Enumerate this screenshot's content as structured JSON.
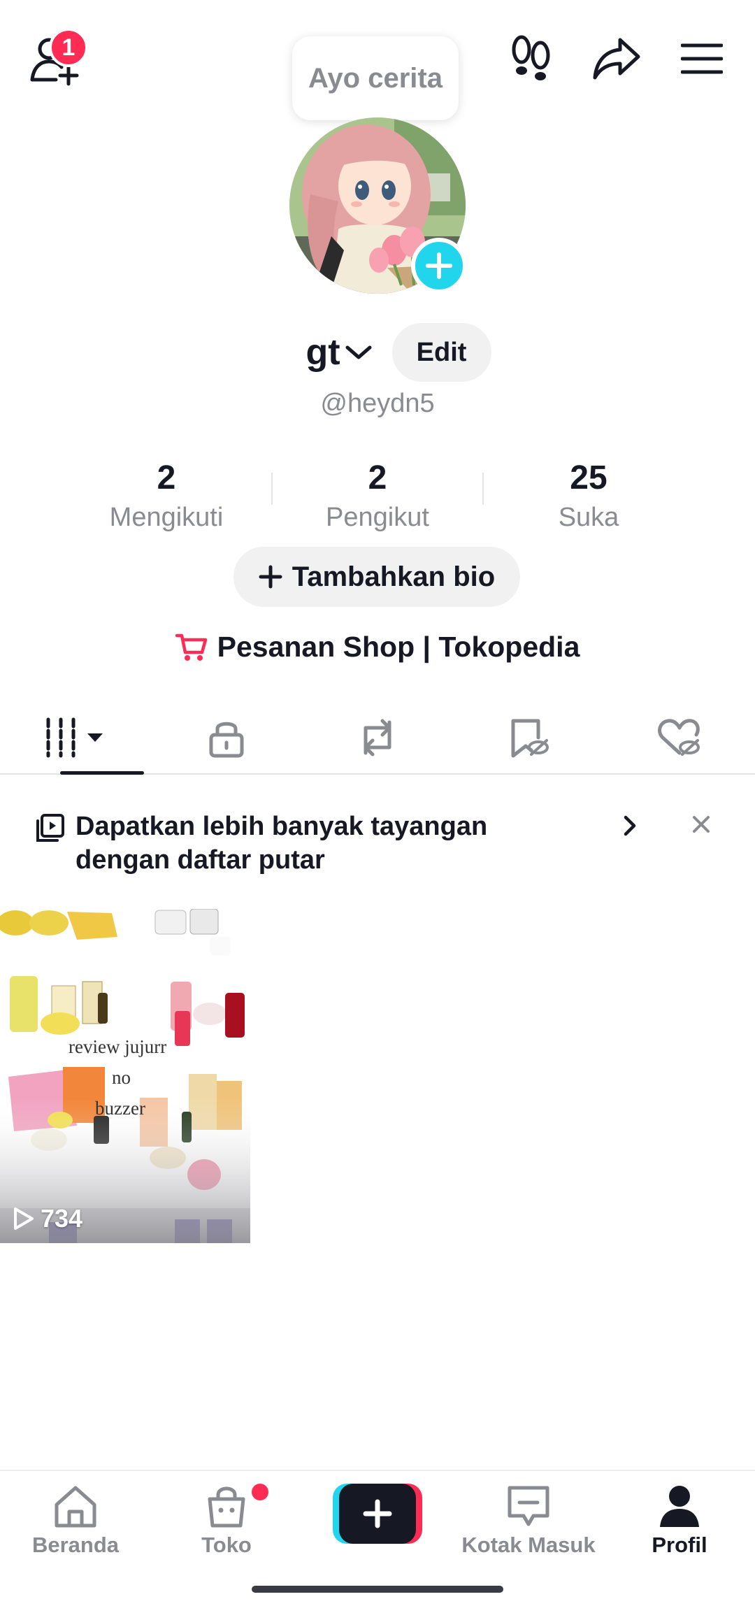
{
  "header": {
    "add_friend_icon": "add-person-icon",
    "notification_count": "1",
    "footprint_icon": "footprints-icon",
    "share_icon": "share-arrow-icon",
    "menu_icon": "hamburger-menu-icon"
  },
  "story": {
    "bubble_text": "Ayo cerita"
  },
  "profile": {
    "username": "gt",
    "edit_label": "Edit",
    "handle": "@heydn5"
  },
  "stats": [
    {
      "value": "2",
      "label": "Mengikuti"
    },
    {
      "value": "2",
      "label": "Pengikut"
    },
    {
      "value": "25",
      "label": "Suka"
    }
  ],
  "bio_button_label": "Tambahkan bio",
  "shop_link_label": "Pesanan Shop | Tokopedia",
  "tabs": [
    {
      "icon": "videos-grid-icon",
      "active": true
    },
    {
      "icon": "lock-icon"
    },
    {
      "icon": "repost-icon"
    },
    {
      "icon": "favorites-hidden-icon"
    },
    {
      "icon": "liked-hidden-icon"
    }
  ],
  "playlist_banner": {
    "text": "Dapatkan lebih banyak tayangan dengan daftar putar"
  },
  "videos": [
    {
      "views": "734",
      "caption_lines": [
        "review jujurr",
        "no",
        "buzzer"
      ]
    }
  ],
  "bottom_nav": {
    "home": "Beranda",
    "shop": "Toko",
    "inbox": "Kotak Masuk",
    "profile": "Profil"
  },
  "colors": {
    "accent_red": "#fe2c55",
    "accent_cyan": "#20d5ec",
    "text_primary": "#161823",
    "text_secondary": "#8a8b91"
  }
}
